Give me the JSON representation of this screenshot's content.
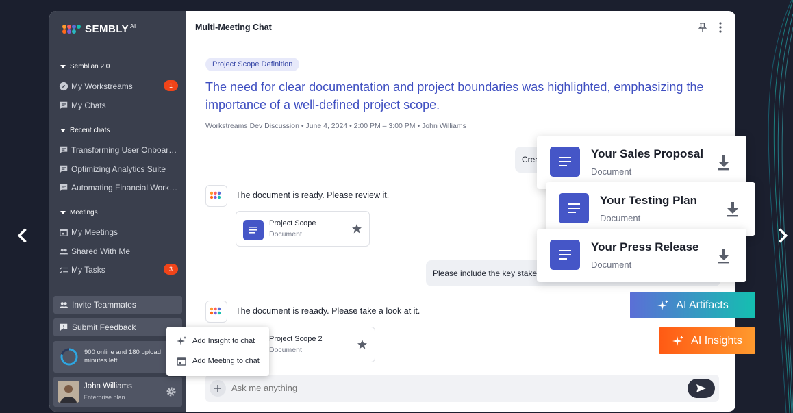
{
  "brand": {
    "name": "SEMBLY",
    "suffix": "AI"
  },
  "sidebar": {
    "section_semblian": "Semblian 2.0",
    "workstreams": {
      "label": "My Workstreams",
      "badge": "1"
    },
    "my_chats": "My Chats",
    "section_recent": "Recent chats",
    "recent": [
      "Transforming User Onboarding",
      "Optimizing Analytics Suite",
      "Automating Financial Workflo..."
    ],
    "section_meetings": "Meetings",
    "my_meetings": "My Meetings",
    "shared": "Shared With Me",
    "tasks": {
      "label": "My Tasks",
      "badge": "3"
    },
    "invite": "Invite Teammates",
    "feedback": "Submit Feedback",
    "quota": "900 online and 180 upload minutes left",
    "user": {
      "name": "John Williams",
      "plan": "Enterprise plan"
    }
  },
  "chat": {
    "title": "Multi-Meeting Chat",
    "tag": "Project Scope Definition",
    "headline": "The need for clear documentation and project boundaries was highlighted, emphasizing the importance of a well-defined project scope.",
    "meta": "Workstreams Dev Discussion  •  June 4, 2024  •  2:00 PM – 3:00 PM  •  John Williams",
    "user_msg_1": "Crea",
    "bot_msg_1": "The document is ready. Please review it.",
    "doc_1": {
      "name": "Project Scope",
      "type": "Document"
    },
    "user_msg_2": "Please include the key stake",
    "bot_msg_2": "The document is reaady. Please take a look at it.",
    "doc_2": {
      "name": "Project Scope 2",
      "type": "Document"
    },
    "input_placeholder": "Ask me anything"
  },
  "context_menu": {
    "add_insight": "Add Insight to chat",
    "add_meeting": "Add Meeting to chat"
  },
  "artifacts": [
    {
      "name": "Your Sales Proposal",
      "type": "Document"
    },
    {
      "name": "Your Testing Plan",
      "type": "Document"
    },
    {
      "name": "Your Press Release",
      "type": "Document"
    }
  ],
  "buttons": {
    "ai_artifacts": "AI Artifacts",
    "ai_insights": "AI Insights"
  },
  "colors": {
    "accent_blue": "#4556c7",
    "badge_red": "#f04419",
    "artifacts_gradient": [
      "#5b6fd6",
      "#14bfb0"
    ],
    "insights_gradient": [
      "#ff6a1a",
      "#ff9a2e"
    ]
  }
}
